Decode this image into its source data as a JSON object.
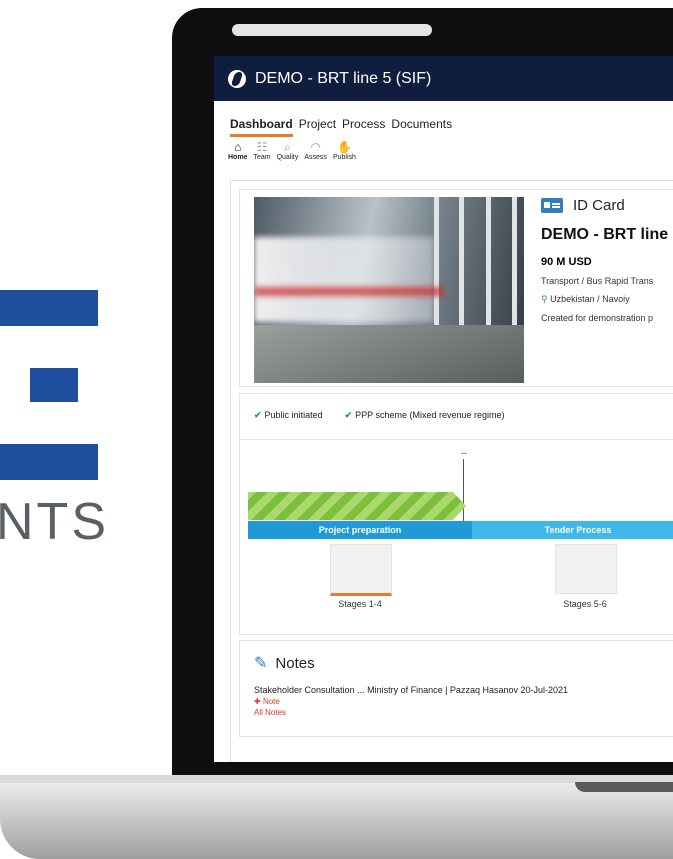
{
  "background_logo": {
    "partial_text": "NTS",
    "color": "#1d4f9e"
  },
  "window": {
    "title": "DEMO - BRT line 5 (SIF)"
  },
  "nav": {
    "tabs": [
      "Dashboard",
      "Project",
      "Process",
      "Documents"
    ],
    "active_tab": "Dashboard"
  },
  "toolbar": {
    "items": [
      {
        "label": "Home",
        "icon": "home-icon",
        "active": true
      },
      {
        "label": "Team",
        "icon": "team-icon",
        "active": false
      },
      {
        "label": "Quality",
        "icon": "magnifier-icon",
        "active": false
      },
      {
        "label": "Assess",
        "icon": "gauge-icon",
        "active": false
      },
      {
        "label": "Publish",
        "icon": "handshake-icon",
        "active": false
      }
    ]
  },
  "id_card": {
    "header": "ID Card",
    "title": "DEMO - BRT line",
    "cost": "90 M USD",
    "sector": "Transport / Bus Rapid Trans",
    "location": "Uzbekistan / Navoiy",
    "description": "Created for demonstration p"
  },
  "status": {
    "checks": [
      "Public initiated",
      "PPP scheme (Mixed revenue regime)"
    ],
    "marker_label": "--",
    "phases": [
      {
        "name": "Project preparation",
        "color": "#1f9ad6"
      },
      {
        "name": "Tender Process",
        "color": "#3fb8e8"
      }
    ],
    "stages": [
      "Stages 1-4",
      "Stages 5-6"
    ],
    "current_stage_color": "#e77b2a"
  },
  "notes": {
    "header": "Notes",
    "entry": "Stakeholder Consultation ...    Ministry of Finance | Pazzaq Hasanov   20-Jul-2021",
    "add_label": "Note",
    "all_label": "All Notes"
  }
}
